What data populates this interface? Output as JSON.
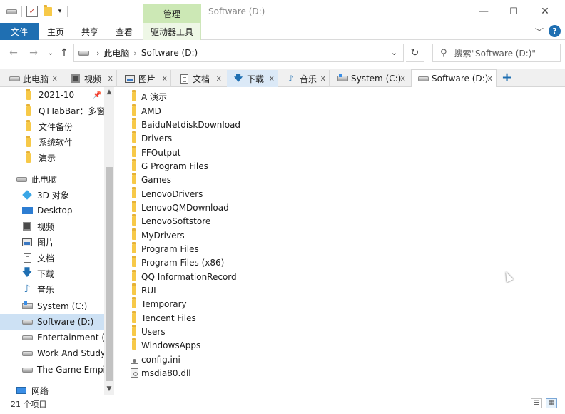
{
  "window": {
    "title": "Software (D:)",
    "manage_tab": "管理"
  },
  "ribbon": {
    "file": "文件",
    "home": "主页",
    "share": "共享",
    "view": "查看",
    "drive_tools": "驱动器工具"
  },
  "address": {
    "this_pc": "此电脑",
    "current": "Software (D:)",
    "search_placeholder": "搜索\"Software (D:)\""
  },
  "qttabs": [
    {
      "label": "此电脑",
      "icon": "computer-icon"
    },
    {
      "label": "视频",
      "icon": "video-icon"
    },
    {
      "label": "图片",
      "icon": "pictures-icon"
    },
    {
      "label": "文档",
      "icon": "documents-icon"
    },
    {
      "label": "下载",
      "icon": "download-icon"
    },
    {
      "label": "音乐",
      "icon": "music-icon"
    },
    {
      "label": "System (C:)",
      "icon": "windows-drive-icon"
    },
    {
      "label": "Software (D:)",
      "icon": "drive-icon"
    }
  ],
  "nav": {
    "quick": [
      {
        "label": "2021-10",
        "pinned": true
      },
      {
        "label": "QTTabBar：多窗口"
      },
      {
        "label": "文件备份"
      },
      {
        "label": "系统软件"
      },
      {
        "label": "演示"
      }
    ],
    "this_pc": "此电脑",
    "pc_items": [
      {
        "label": "3D 对象",
        "icon": "3d-objects-icon"
      },
      {
        "label": "Desktop",
        "icon": "desktop-icon"
      },
      {
        "label": "视频",
        "icon": "video-icon"
      },
      {
        "label": "图片",
        "icon": "pictures-icon"
      },
      {
        "label": "文档",
        "icon": "documents-icon"
      },
      {
        "label": "下载",
        "icon": "download-icon"
      },
      {
        "label": "音乐",
        "icon": "music-icon"
      },
      {
        "label": "System (C:)",
        "icon": "windows-drive-icon"
      },
      {
        "label": "Software (D:)",
        "icon": "drive-icon",
        "selected": true
      },
      {
        "label": "Entertainment (E:)",
        "icon": "drive-icon"
      },
      {
        "label": "Work And Study (F:)",
        "icon": "drive-icon"
      },
      {
        "label": "The Game Empire",
        "icon": "drive-icon"
      }
    ],
    "network": "网络"
  },
  "files": [
    {
      "name": "A 演示",
      "type": "folder"
    },
    {
      "name": "AMD",
      "type": "folder"
    },
    {
      "name": "BaiduNetdiskDownload",
      "type": "folder"
    },
    {
      "name": "Drivers",
      "type": "folder"
    },
    {
      "name": "FFOutput",
      "type": "folder"
    },
    {
      "name": "G Program Files",
      "type": "folder"
    },
    {
      "name": "Games",
      "type": "folder"
    },
    {
      "name": "LenovoDrivers",
      "type": "folder"
    },
    {
      "name": "LenovoQMDownload",
      "type": "folder"
    },
    {
      "name": "LenovoSoftstore",
      "type": "folder"
    },
    {
      "name": "MyDrivers",
      "type": "folder"
    },
    {
      "name": "Program Files",
      "type": "folder"
    },
    {
      "name": "Program Files (x86)",
      "type": "folder"
    },
    {
      "name": "QQ InformationRecord",
      "type": "folder"
    },
    {
      "name": "RUI",
      "type": "folder"
    },
    {
      "name": "Temporary",
      "type": "folder"
    },
    {
      "name": "Tencent Files",
      "type": "folder"
    },
    {
      "name": "Users",
      "type": "folder"
    },
    {
      "name": "WindowsApps",
      "type": "folder"
    },
    {
      "name": "config.ini",
      "type": "ini"
    },
    {
      "name": "msdia80.dll",
      "type": "dll"
    }
  ],
  "status": {
    "count": "21 个项目"
  },
  "colors": {
    "accent": "#1f6fb2",
    "manage_tab": "#cce8b5",
    "selection": "#cde1f4",
    "folder": "#f7c948"
  }
}
